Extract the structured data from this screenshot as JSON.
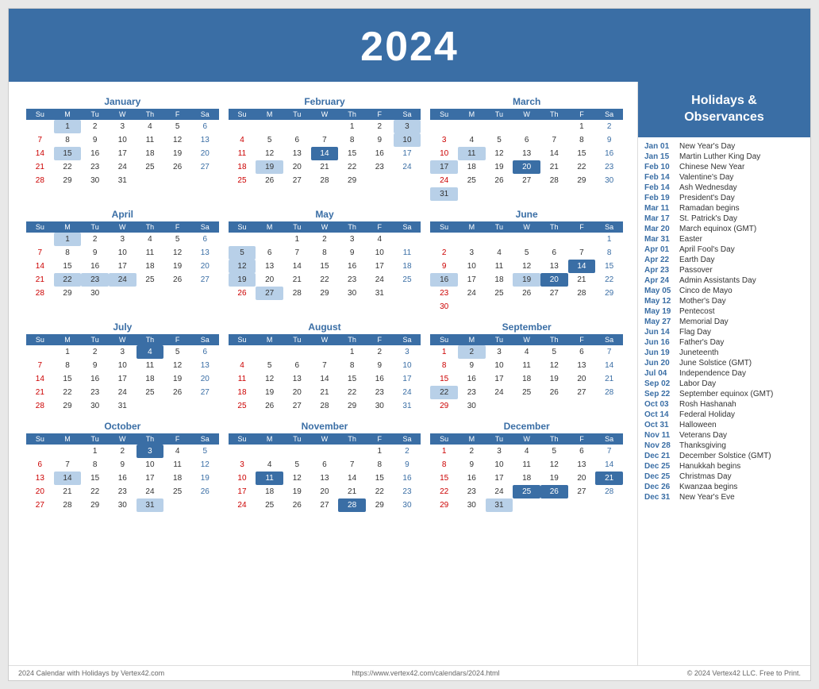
{
  "title": "2024",
  "calendar": {
    "months": [
      {
        "name": "January",
        "days_in_week": [
          [
            "",
            "",
            "",
            "",
            "",
            "",
            ""
          ],
          [
            "Su",
            "M",
            "Tu",
            "W",
            "Th",
            "F",
            "Sa"
          ],
          [
            "",
            "1",
            "2",
            "3",
            "4",
            "5",
            "6"
          ],
          [
            "7",
            "8",
            "9",
            "10",
            "11",
            "12",
            "13"
          ],
          [
            "14",
            "15",
            "16",
            "17",
            "18",
            "19",
            "20"
          ],
          [
            "21",
            "22",
            "23",
            "24",
            "25",
            "26",
            "27"
          ],
          [
            "28",
            "29",
            "30",
            "31",
            "",
            "",
            ""
          ]
        ],
        "highlights": {
          "blue": [
            "1"
          ],
          "dark": []
        },
        "special": {
          "15": "blue"
        }
      },
      {
        "name": "February",
        "days": [
          [
            "",
            "",
            "",
            "",
            "1",
            "2",
            "3"
          ],
          [
            "4",
            "5",
            "6",
            "7",
            "8",
            "9",
            "10"
          ],
          [
            "11",
            "12",
            "13",
            "14",
            "15",
            "16",
            "17"
          ],
          [
            "18",
            "19",
            "20",
            "21",
            "22",
            "23",
            "24"
          ],
          [
            "25",
            "26",
            "27",
            "28",
            "29",
            "",
            ""
          ]
        ],
        "highlights_blue": [
          "3",
          "10",
          "14",
          "19"
        ],
        "highlights_dark": [
          "14"
        ]
      },
      {
        "name": "March",
        "days": [
          [
            "",
            "",
            "",
            "",
            "",
            "1",
            "2"
          ],
          [
            "3",
            "4",
            "5",
            "6",
            "7",
            "8",
            "9"
          ],
          [
            "10",
            "11",
            "12",
            "13",
            "14",
            "15",
            "16"
          ],
          [
            "17",
            "18",
            "19",
            "20",
            "21",
            "22",
            "23"
          ],
          [
            "24",
            "25",
            "26",
            "27",
            "28",
            "29",
            "30"
          ],
          [
            "31",
            "",
            "",
            "",
            "",
            "",
            ""
          ]
        ],
        "highlights_blue": [
          "11",
          "17",
          "20",
          "31"
        ],
        "highlights_dark": [
          "20"
        ]
      },
      {
        "name": "April",
        "days": [
          [
            "",
            "1",
            "2",
            "3",
            "4",
            "5",
            "6"
          ],
          [
            "7",
            "8",
            "9",
            "10",
            "11",
            "12",
            "13"
          ],
          [
            "14",
            "15",
            "16",
            "17",
            "18",
            "19",
            "20"
          ],
          [
            "21",
            "22",
            "23",
            "24",
            "25",
            "26",
            "27"
          ],
          [
            "28",
            "29",
            "30",
            "",
            "",
            "",
            ""
          ]
        ],
        "highlights_blue": [
          "1",
          "22",
          "23",
          "24"
        ],
        "highlights_dark": []
      },
      {
        "name": "May",
        "days": [
          [
            "",
            "",
            "1",
            "2",
            "3",
            "4",
            ""
          ],
          [
            "5",
            "6",
            "7",
            "8",
            "9",
            "10",
            "11"
          ],
          [
            "12",
            "13",
            "14",
            "15",
            "16",
            "17",
            "18"
          ],
          [
            "19",
            "20",
            "21",
            "22",
            "23",
            "24",
            "25"
          ],
          [
            "26",
            "27",
            "28",
            "29",
            "30",
            "31",
            ""
          ]
        ],
        "highlights_blue": [
          "5",
          "12",
          "19",
          "27"
        ],
        "highlights_dark": []
      },
      {
        "name": "June",
        "days": [
          [
            "",
            "",
            "",
            "",
            "",
            "",
            "1"
          ],
          [
            "2",
            "3",
            "4",
            "5",
            "6",
            "7",
            "8"
          ],
          [
            "9",
            "10",
            "11",
            "12",
            "13",
            "14",
            "15"
          ],
          [
            "16",
            "17",
            "18",
            "19",
            "20",
            "21",
            "22"
          ],
          [
            "23",
            "24",
            "25",
            "26",
            "27",
            "28",
            "29"
          ],
          [
            "30",
            "",
            "",
            "",
            "",
            "",
            ""
          ]
        ],
        "highlights_blue": [
          "14",
          "16",
          "19",
          "20"
        ],
        "highlights_dark": [
          "14",
          "20"
        ]
      },
      {
        "name": "July",
        "days": [
          [
            "",
            "1",
            "2",
            "3",
            "4",
            "5",
            "6"
          ],
          [
            "7",
            "8",
            "9",
            "10",
            "11",
            "12",
            "13"
          ],
          [
            "14",
            "15",
            "16",
            "17",
            "18",
            "19",
            "20"
          ],
          [
            "21",
            "22",
            "23",
            "24",
            "25",
            "26",
            "27"
          ],
          [
            "28",
            "29",
            "30",
            "31",
            "",
            "",
            ""
          ]
        ],
        "highlights_blue": [
          "4"
        ],
        "highlights_dark": [
          "4"
        ]
      },
      {
        "name": "August",
        "days": [
          [
            "",
            "",
            "",
            "",
            "1",
            "2",
            "3"
          ],
          [
            "4",
            "5",
            "6",
            "7",
            "8",
            "9",
            "10"
          ],
          [
            "11",
            "12",
            "13",
            "14",
            "15",
            "16",
            "17"
          ],
          [
            "18",
            "19",
            "20",
            "21",
            "22",
            "23",
            "24"
          ],
          [
            "25",
            "26",
            "27",
            "28",
            "29",
            "30",
            "31"
          ]
        ],
        "highlights_blue": [],
        "highlights_dark": []
      },
      {
        "name": "September",
        "days": [
          [
            "1",
            "2",
            "3",
            "4",
            "5",
            "6",
            "7"
          ],
          [
            "8",
            "9",
            "10",
            "11",
            "12",
            "13",
            "14"
          ],
          [
            "15",
            "16",
            "17",
            "18",
            "19",
            "20",
            "21"
          ],
          [
            "22",
            "23",
            "24",
            "25",
            "26",
            "27",
            "28"
          ],
          [
            "29",
            "30",
            "",
            "",
            "",
            "",
            ""
          ]
        ],
        "highlights_blue": [
          "2",
          "22"
        ],
        "highlights_dark": []
      },
      {
        "name": "October",
        "days": [
          [
            "",
            "",
            "1",
            "2",
            "3",
            "4",
            "5"
          ],
          [
            "6",
            "7",
            "8",
            "9",
            "10",
            "11",
            "12"
          ],
          [
            "13",
            "14",
            "15",
            "16",
            "17",
            "18",
            "19"
          ],
          [
            "20",
            "21",
            "22",
            "23",
            "24",
            "25",
            "26"
          ],
          [
            "27",
            "28",
            "29",
            "30",
            "31",
            "",
            ""
          ]
        ],
        "highlights_blue": [
          "3",
          "14",
          "31"
        ],
        "highlights_dark": [
          "3"
        ]
      },
      {
        "name": "November",
        "days": [
          [
            "",
            "",
            "",
            "",
            "",
            "1",
            "2"
          ],
          [
            "3",
            "4",
            "5",
            "6",
            "7",
            "8",
            "9"
          ],
          [
            "10",
            "11",
            "12",
            "13",
            "14",
            "15",
            "16"
          ],
          [
            "17",
            "18",
            "19",
            "20",
            "21",
            "22",
            "23"
          ],
          [
            "24",
            "25",
            "26",
            "27",
            "28",
            "29",
            "30"
          ]
        ],
        "highlights_blue": [
          "11",
          "28"
        ],
        "highlights_dark": [
          "11",
          "28"
        ]
      },
      {
        "name": "December",
        "days": [
          [
            "1",
            "2",
            "3",
            "4",
            "5",
            "6",
            "7"
          ],
          [
            "8",
            "9",
            "10",
            "11",
            "12",
            "13",
            "14"
          ],
          [
            "15",
            "16",
            "17",
            "18",
            "19",
            "20",
            "21"
          ],
          [
            "22",
            "23",
            "24",
            "25",
            "26",
            "27",
            "28"
          ],
          [
            "29",
            "30",
            "31",
            "",
            "",
            "",
            ""
          ]
        ],
        "highlights_blue": [
          "21",
          "25",
          "26",
          "31"
        ],
        "highlights_dark": [
          "21",
          "25",
          "26"
        ]
      }
    ]
  },
  "sidebar": {
    "title": "Holidays &\nObservances",
    "holidays": [
      {
        "date": "Jan 01",
        "name": "New Year's Day"
      },
      {
        "date": "Jan 15",
        "name": "Martin Luther King Day"
      },
      {
        "date": "Feb 10",
        "name": "Chinese New Year"
      },
      {
        "date": "Feb 14",
        "name": "Valentine's Day"
      },
      {
        "date": "Feb 14",
        "name": "Ash Wednesday"
      },
      {
        "date": "Feb 19",
        "name": "President's Day"
      },
      {
        "date": "Mar 11",
        "name": "Ramadan begins"
      },
      {
        "date": "Mar 17",
        "name": "St. Patrick's Day"
      },
      {
        "date": "Mar 20",
        "name": "March equinox (GMT)"
      },
      {
        "date": "Mar 31",
        "name": "Easter"
      },
      {
        "date": "Apr 01",
        "name": "April Fool's Day"
      },
      {
        "date": "Apr 22",
        "name": "Earth Day"
      },
      {
        "date": "Apr 23",
        "name": "Passover"
      },
      {
        "date": "Apr 24",
        "name": "Admin Assistants Day"
      },
      {
        "date": "May 05",
        "name": "Cinco de Mayo"
      },
      {
        "date": "May 12",
        "name": "Mother's Day"
      },
      {
        "date": "May 19",
        "name": "Pentecost"
      },
      {
        "date": "May 27",
        "name": "Memorial Day"
      },
      {
        "date": "Jun 14",
        "name": "Flag Day"
      },
      {
        "date": "Jun 16",
        "name": "Father's Day"
      },
      {
        "date": "Jun 19",
        "name": "Juneteenth"
      },
      {
        "date": "Jun 20",
        "name": "June Solstice (GMT)"
      },
      {
        "date": "Jul 04",
        "name": "Independence Day"
      },
      {
        "date": "Sep 02",
        "name": "Labor Day"
      },
      {
        "date": "Sep 22",
        "name": "September equinox (GMT)"
      },
      {
        "date": "Oct 03",
        "name": "Rosh Hashanah"
      },
      {
        "date": "Oct 14",
        "name": "Federal Holiday"
      },
      {
        "date": "Oct 31",
        "name": "Halloween"
      },
      {
        "date": "Nov 11",
        "name": "Veterans Day"
      },
      {
        "date": "Nov 28",
        "name": "Thanksgiving"
      },
      {
        "date": "Dec 21",
        "name": "December Solstice (GMT)"
      },
      {
        "date": "Dec 25",
        "name": "Hanukkah begins"
      },
      {
        "date": "Dec 25",
        "name": "Christmas Day"
      },
      {
        "date": "Dec 26",
        "name": "Kwanzaa begins"
      },
      {
        "date": "Dec 31",
        "name": "New Year's Eve"
      }
    ]
  },
  "footer": {
    "left": "2024 Calendar with Holidays by Vertex42.com",
    "center": "https://www.vertex42.com/calendars/2024.html",
    "right": "© 2024 Vertex42 LLC. Free to Print."
  }
}
